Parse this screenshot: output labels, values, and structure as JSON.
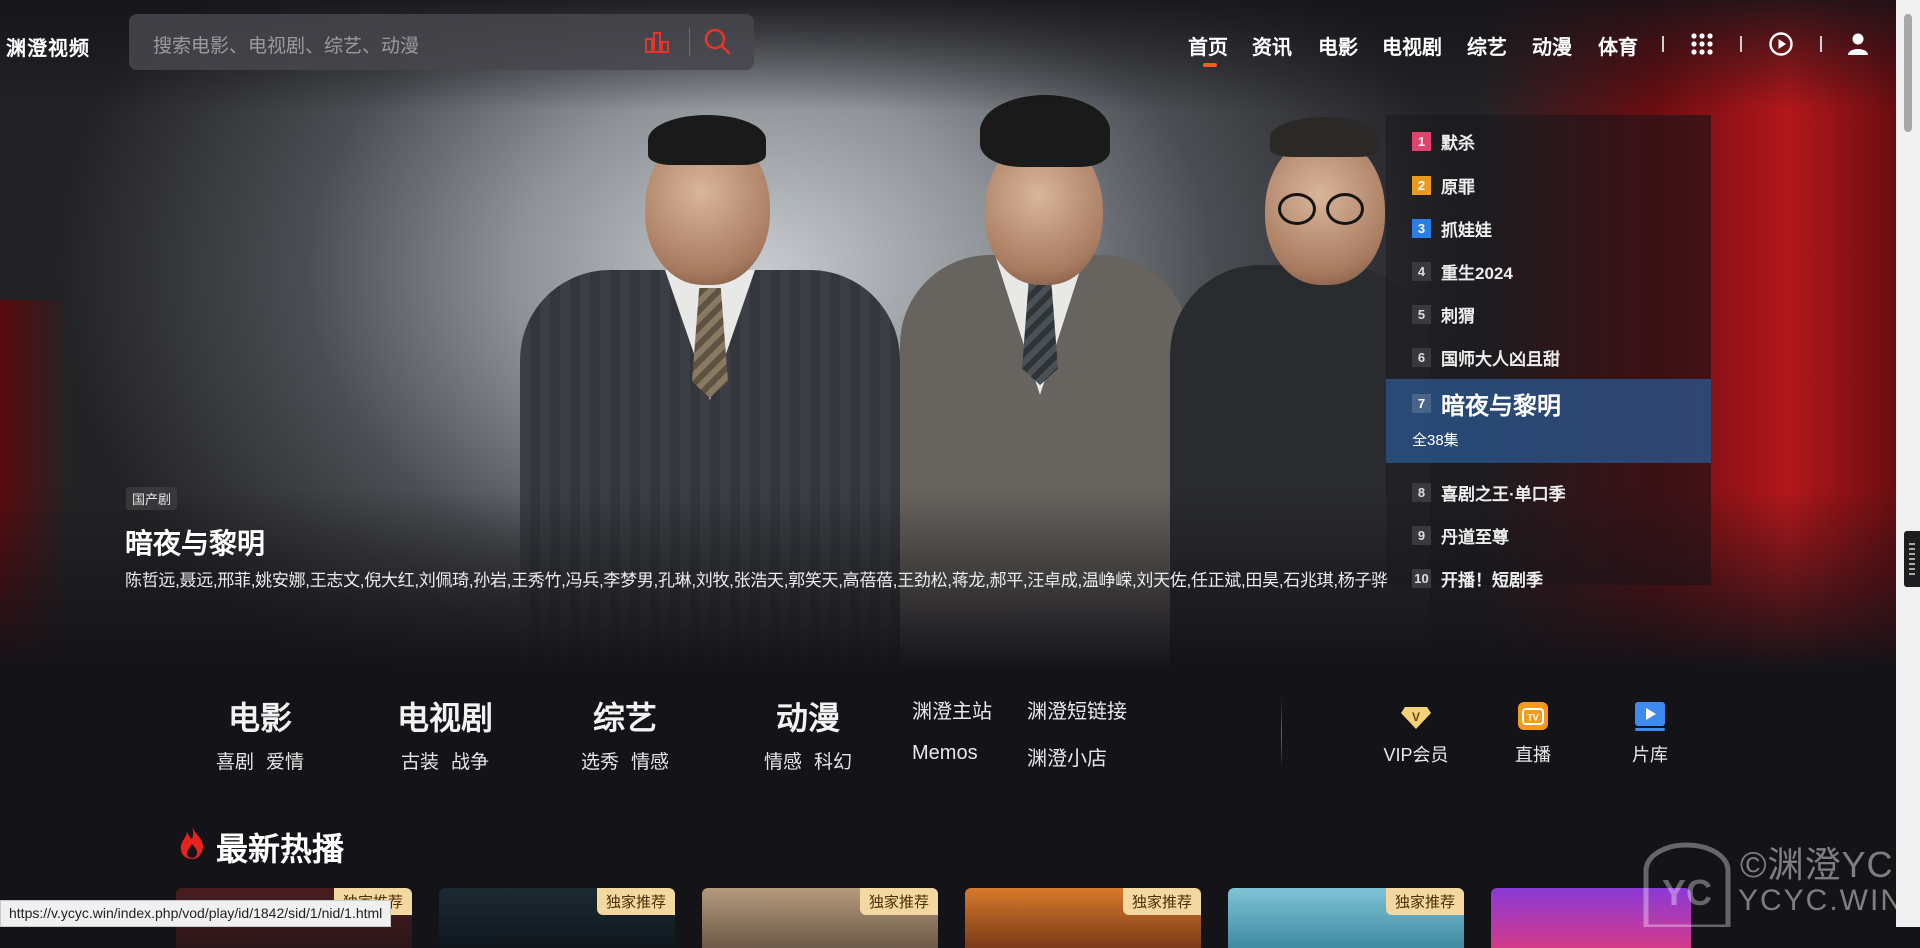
{
  "brand": {
    "logo_text": "渊澄视频"
  },
  "search": {
    "placeholder": "搜索电影、电视剧、综艺、动漫"
  },
  "nav": {
    "items": [
      "首页",
      "资讯",
      "电影",
      "电视剧",
      "综艺",
      "动漫",
      "体育"
    ],
    "active_index": 0,
    "icons": [
      "grid-menu-icon",
      "play-history-icon",
      "user-icon"
    ]
  },
  "hero": {
    "tag": "国产剧",
    "title": "暗夜与黎明",
    "cast": "陈哲远,聂远,邢菲,姚安娜,王志文,倪大红,刘佩琦,孙岩,王秀竹,冯兵,李梦男,孔琳,刘牧,张浩天,郭笑天,高蓓蓓,王劲松,蒋龙,郝平,汪卓成,温峥嵘,刘天佐,任正斌,田昊,石兆琪,杨子骅"
  },
  "rank": {
    "items": [
      {
        "num": "1",
        "name": "默杀",
        "color": "#e0436c"
      },
      {
        "num": "2",
        "name": "原罪",
        "color": "#e89b1e"
      },
      {
        "num": "3",
        "name": "抓娃娃",
        "color": "#2a7de1"
      },
      {
        "num": "4",
        "name": "重生2024"
      },
      {
        "num": "5",
        "name": "刺猬"
      },
      {
        "num": "6",
        "name": "国师大人凶且甜"
      },
      {
        "num": "7",
        "name": "暗夜与黎明",
        "sub": "全38集"
      },
      {
        "num": "8",
        "name": "喜剧之王·单口季"
      },
      {
        "num": "9",
        "name": "丹道至尊"
      },
      {
        "num": "10",
        "name": "开播！短剧季"
      }
    ],
    "active_index": 6
  },
  "categories": [
    {
      "title": "电影",
      "subs": [
        "喜剧",
        "爱情"
      ]
    },
    {
      "title": "电视剧",
      "subs": [
        "古装",
        "战争"
      ]
    },
    {
      "title": "综艺",
      "subs": [
        "选秀",
        "情感"
      ]
    },
    {
      "title": "动漫",
      "subs": [
        "情感",
        "科幻"
      ]
    }
  ],
  "links": [
    "渊澄主站",
    "渊澄短链接",
    "Memos",
    "渊澄小店"
  ],
  "quick": [
    {
      "label": "VIP会员",
      "icon": "vip-icon",
      "color": "#f4d27a"
    },
    {
      "label": "直播",
      "icon": "live-tv-icon",
      "color": "#f59b1c"
    },
    {
      "label": "片库",
      "icon": "library-icon",
      "color": "#3d8bf0"
    }
  ],
  "section": {
    "title": "最新热播",
    "badge": "独家推荐"
  },
  "status_url": "https://v.ycyc.win/index.php/vod/play/id/1842/sid/1/nid/1.html",
  "watermark": {
    "line1": "©渊澄YC",
    "line2": "YCYC.WIN",
    "mark": "YC"
  }
}
